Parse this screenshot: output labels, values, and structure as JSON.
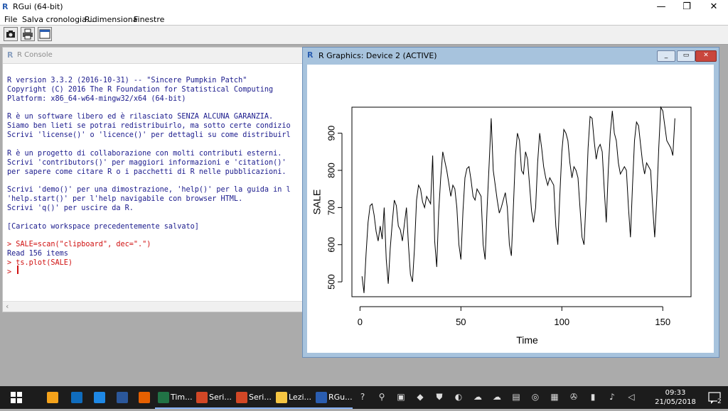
{
  "app": {
    "title": "RGui (64-bit)",
    "min_symbol": "—",
    "max_symbol": "❐",
    "close_symbol": "✕"
  },
  "menu": [
    "File",
    "Salva cronologia...",
    "Ridimensiona",
    "Finestre"
  ],
  "toolbar": {
    "icons": [
      "camera-icon",
      "print-icon",
      "window-icon"
    ]
  },
  "console": {
    "title": "R Console",
    "lines": [
      {
        "text": "R version 3.3.2 (2016-10-31) -- \"Sincere Pumpkin Patch\"",
        "color": "blue"
      },
      {
        "text": "Copyright (C) 2016 The R Foundation for Statistical Computing",
        "color": "blue"
      },
      {
        "text": "Platform: x86_64-w64-mingw32/x64 (64-bit)",
        "color": "blue"
      },
      {
        "text": "",
        "color": "blue"
      },
      {
        "text": "R è un software libero ed è rilasciato SENZA ALCUNA GARANZIA.",
        "color": "blue"
      },
      {
        "text": "Siamo ben lieti se potrai redistribuirlo, ma sotto certe condizio",
        "color": "blue"
      },
      {
        "text": "Scrivi 'license()' o 'licence()' per dettagli su come distribuirl",
        "color": "blue"
      },
      {
        "text": "",
        "color": "blue"
      },
      {
        "text": "R è un progetto di collaborazione con molti contributi esterni.",
        "color": "blue"
      },
      {
        "text": "Scrivi 'contributors()' per maggiori informazioni e 'citation()'",
        "color": "blue"
      },
      {
        "text": "per sapere come citare R o i pacchetti di R nelle pubblicazioni.",
        "color": "blue"
      },
      {
        "text": "",
        "color": "blue"
      },
      {
        "text": "Scrivi 'demo()' per una dimostrazione, 'help()' per la guida in l",
        "color": "blue"
      },
      {
        "text": "'help.start()' per l'help navigabile con browser HTML.",
        "color": "blue"
      },
      {
        "text": "Scrivi 'q()' per uscire da R.",
        "color": "blue"
      },
      {
        "text": "",
        "color": "blue"
      },
      {
        "text": "[Caricato workspace precedentemente salvato]",
        "color": "blue"
      },
      {
        "text": "",
        "color": "blue"
      },
      {
        "text": "> SALE=scan(\"clipboard\", dec=\".\")",
        "color": "red"
      },
      {
        "text": "Read 156 items",
        "color": "blue"
      },
      {
        "text": "> ts.plot(SALE)",
        "color": "red"
      },
      {
        "text": "> ",
        "color": "red"
      }
    ]
  },
  "graphics_window": {
    "title": "R Graphics: Device 2 (ACTIVE)"
  },
  "chart_data": {
    "type": "line",
    "xlabel": "Time",
    "ylabel": "SALE",
    "xlim": [
      0,
      160
    ],
    "ylim": [
      460,
      970
    ],
    "xticks": [
      0,
      50,
      100,
      150
    ],
    "yticks": [
      500,
      600,
      700,
      800,
      900
    ],
    "grid": false,
    "series": [
      {
        "values": [
          515,
          470,
          575,
          660,
          705,
          710,
          680,
          635,
          610,
          650,
          615,
          700,
          560,
          495,
          590,
          660,
          720,
          705,
          650,
          640,
          610,
          655,
          700,
          600,
          520,
          500,
          590,
          720,
          760,
          750,
          715,
          700,
          730,
          720,
          710,
          840,
          610,
          540,
          690,
          780,
          850,
          825,
          800,
          765,
          730,
          760,
          750,
          700,
          600,
          560,
          690,
          780,
          805,
          810,
          775,
          730,
          720,
          750,
          740,
          730,
          600,
          560,
          700,
          820,
          940,
          800,
          760,
          720,
          685,
          700,
          720,
          740,
          700,
          600,
          570,
          700,
          840,
          900,
          880,
          800,
          790,
          850,
          830,
          760,
          690,
          660,
          700,
          820,
          900,
          860,
          810,
          780,
          760,
          780,
          770,
          760,
          650,
          600,
          730,
          850,
          910,
          900,
          880,
          820,
          780,
          810,
          800,
          780,
          700,
          620,
          600,
          720,
          860,
          945,
          940,
          880,
          830,
          860,
          870,
          850,
          750,
          660,
          800,
          900,
          960,
          900,
          880,
          820,
          790,
          800,
          810,
          800,
          700,
          620,
          760,
          880,
          930,
          920,
          870,
          820,
          790,
          820,
          810,
          800,
          700,
          620,
          720,
          860,
          970,
          960,
          920,
          880,
          870,
          860,
          840,
          940
        ]
      }
    ]
  },
  "taskbar": {
    "items": [
      {
        "name": "start-button",
        "label": "",
        "color": "#ffffff"
      },
      {
        "name": "store-icon",
        "label": "",
        "color": "#f4a21a"
      },
      {
        "name": "outlook-icon",
        "label": "",
        "color": "#0f6cbd"
      },
      {
        "name": "edge-icon",
        "label": "",
        "color": "#1e88e5"
      },
      {
        "name": "word-icon",
        "label": "",
        "color": "#2b579a"
      },
      {
        "name": "firefox-icon",
        "label": "",
        "color": "#e66000"
      },
      {
        "name": "excel-icon",
        "label": "Tim...",
        "color": "#217346"
      },
      {
        "name": "powerpoint-icon",
        "label": "Seri...",
        "color": "#d24726"
      },
      {
        "name": "powerpoint-icon",
        "label": "Seri...",
        "color": "#d24726"
      },
      {
        "name": "folder-icon",
        "label": "Lezi...",
        "color": "#f5c542"
      },
      {
        "name": "rgui-icon",
        "label": "RGu...",
        "color": "#2a5db0"
      }
    ],
    "tray_icons": [
      "help-icon",
      "people-icon",
      "network-icon",
      "dropbox-icon",
      "defender-icon",
      "acrobat-icon",
      "onedrive-icon",
      "cloud-icon",
      "cloud-icon",
      "clipboard-icon",
      "vpn-icon",
      "language-icon",
      "gamepad-icon",
      "battery-icon",
      "volume-icon"
    ],
    "time": "09:33",
    "date": "21/05/2018",
    "notifications": "2"
  }
}
